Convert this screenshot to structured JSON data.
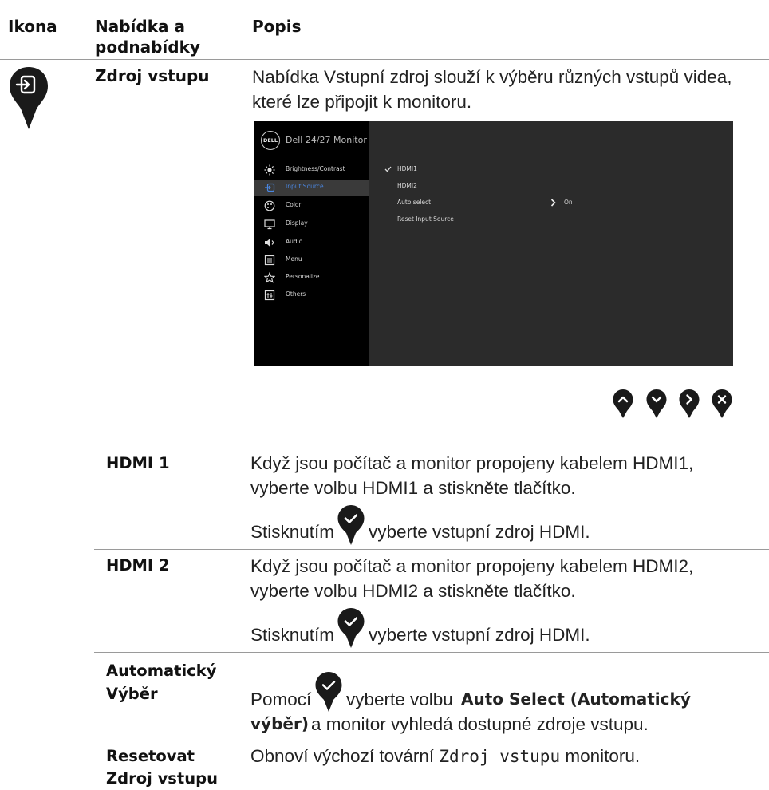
{
  "table": {
    "headers": {
      "icon": "Ikona",
      "menu": "Nabídka a podnabídky",
      "desc": "Popis"
    },
    "section": {
      "name": "Zdroj vstupu",
      "intro": "Nabídka Vstupní zdroj slouží k výběru různých vstupů videa, které lze připojit k monitoru."
    },
    "rows": [
      {
        "label": "HDMI 1",
        "line1": "Když jsou počítač a monitor propojeny kabelem HDMI1,",
        "line2": "vyberte volbu HDMI1 a stiskněte tlačítko.",
        "pre": "Stisknutím",
        "post": "vyberte vstupní zdroj HDMI."
      },
      {
        "label": "HDMI 2",
        "line1": "Když jsou počítač a monitor propojeny kabelem HDMI2,",
        "line2": "vyberte volbu HDMI2 a stiskněte tlačítko.",
        "pre": "Stisknutím",
        "post": "vyberte vstupní zdroj HDMI."
      },
      {
        "label1": "Automatický",
        "label2": "Výběr",
        "pre": "Pomocí",
        "post": "vyberte volbu",
        "bold1": "Auto Select (Automatický",
        "bold2": "výběr)",
        "rest": "a monitor vyhledá dostupné zdroje vstupu."
      },
      {
        "label1": "Resetovat",
        "label2": "Zdroj vstupu",
        "text_pre": "Obnoví výchozí tovární",
        "text_mono": "Zdroj vstupu",
        "text_post": "monitoru."
      }
    ]
  },
  "osd": {
    "logo": "DELL",
    "title": "Dell 24/27 Monitor",
    "menu": [
      {
        "label": "Brightness/Contrast",
        "icon": "brightness-icon"
      },
      {
        "label": "Input Source",
        "icon": "input-source-icon",
        "active": true
      },
      {
        "label": "Color",
        "icon": "color-icon"
      },
      {
        "label": "Display",
        "icon": "display-icon"
      },
      {
        "label": "Audio",
        "icon": "audio-icon"
      },
      {
        "label": "Menu",
        "icon": "menu-icon"
      },
      {
        "label": "Personalize",
        "icon": "star-icon"
      },
      {
        "label": "Others",
        "icon": "others-icon"
      }
    ],
    "options": [
      {
        "label": "HDMI1",
        "checked": true
      },
      {
        "label": "HDMI2"
      },
      {
        "label": "Auto select",
        "value": "On"
      },
      {
        "label": "Reset Input Source"
      }
    ],
    "accent": "#4a86e0"
  },
  "nav_buttons": [
    "up-arrow-icon",
    "down-arrow-icon",
    "right-arrow-icon",
    "close-icon"
  ],
  "pin_color": "#1a1a1a"
}
